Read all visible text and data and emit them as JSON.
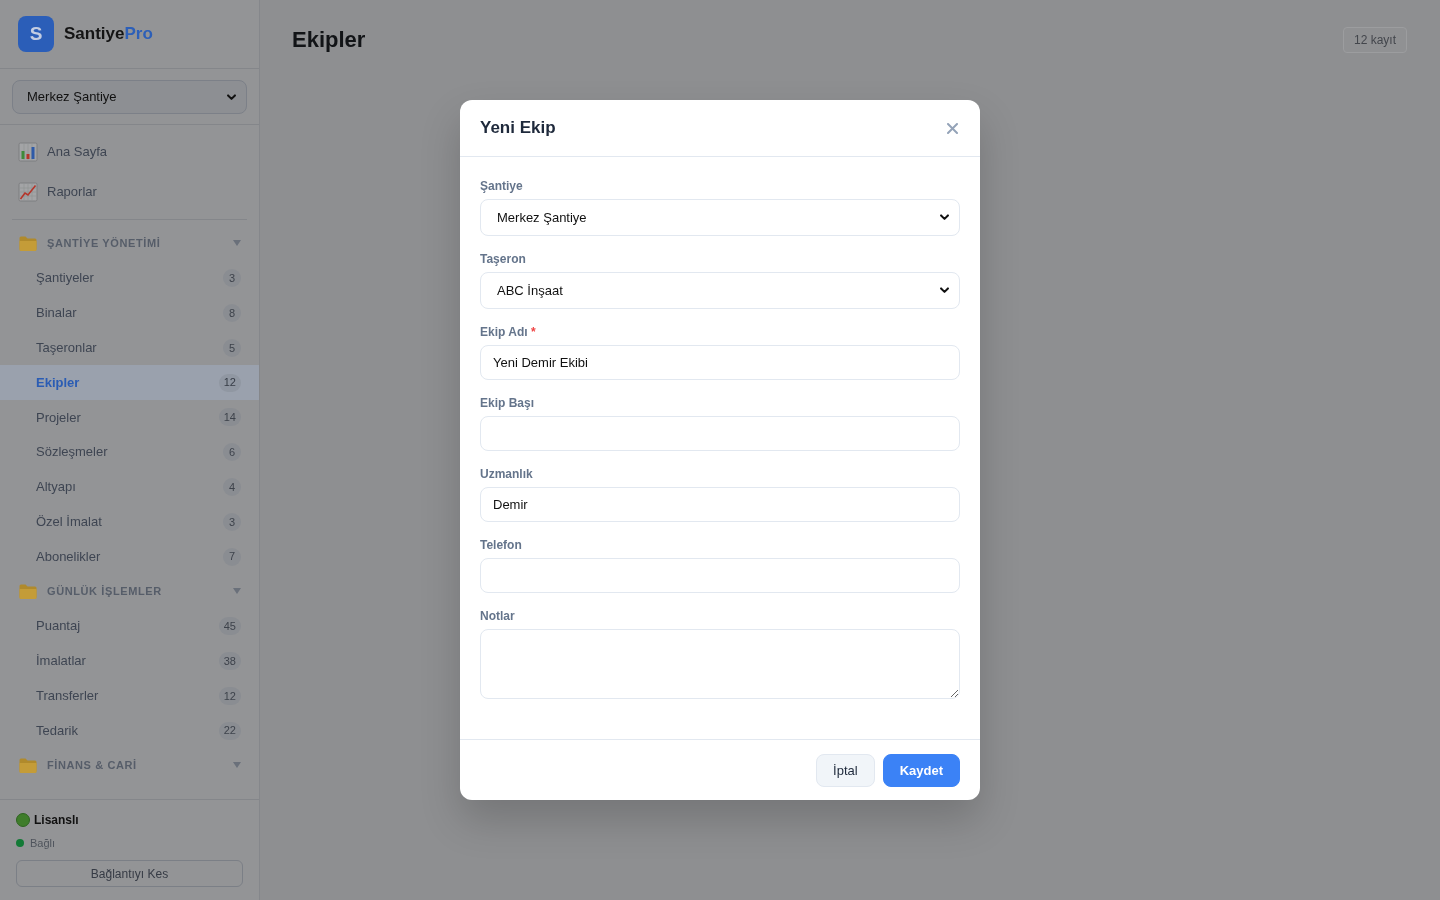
{
  "sidebar": {
    "brand": {
      "logo_letter": "S",
      "name": "Santiye",
      "name_accent": "Pro"
    },
    "site_select": {
      "value": "Merkez Şantiye"
    },
    "nav": [
      {
        "label": "Ana Sayfa",
        "selected": false
      },
      {
        "label": "Raporlar",
        "selected": false
      }
    ],
    "sections": [
      {
        "title": "ŞANTİYE YÖNETİMİ",
        "expanded": true,
        "items": [
          {
            "label": "Şantiyeler",
            "count": "3",
            "selected": false
          },
          {
            "label": "Binalar",
            "count": "8",
            "selected": false
          },
          {
            "label": "Taşeronlar",
            "count": "5",
            "selected": false
          },
          {
            "label": "Ekipler",
            "count": "12",
            "selected": true
          },
          {
            "label": "Projeler",
            "count": "14",
            "selected": false
          },
          {
            "label": "Sözleşmeler",
            "count": "6",
            "selected": false
          },
          {
            "label": "Altyapı",
            "count": "4",
            "selected": false
          },
          {
            "label": "Özel İmalat",
            "count": "3",
            "selected": false
          },
          {
            "label": "Abonelikler",
            "count": "7",
            "selected": false
          }
        ]
      },
      {
        "title": "GÜNLÜK İŞLEMLER",
        "expanded": true,
        "items": [
          {
            "label": "Puantaj",
            "count": "45",
            "selected": false
          },
          {
            "label": "İmalatlar",
            "count": "38",
            "selected": false
          },
          {
            "label": "Transferler",
            "count": "12",
            "selected": false
          },
          {
            "label": "Tedarik",
            "count": "22",
            "selected": false
          }
        ]
      },
      {
        "title": "FİNANS & CARİ",
        "expanded": true
      }
    ],
    "footer": {
      "license": "Lisanslı",
      "connection": "Bağlı",
      "connected": true,
      "disconnect_button": "Bağlantıyı Kes"
    }
  },
  "page": {
    "title": "Ekipler",
    "record_count": "12 kayıt"
  },
  "modal": {
    "title": "Yeni Ekip",
    "fields": [
      {
        "kind": "select",
        "label": "Şantiye",
        "value": "Merkez Şantiye"
      },
      {
        "kind": "select",
        "label": "Taşeron",
        "value": "ABC İnşaat"
      },
      {
        "kind": "text",
        "label": "Ekip Adı",
        "required_mark": "*",
        "value": "Yeni Demir Ekibi"
      },
      {
        "kind": "text",
        "label": "Ekip Başı"
      },
      {
        "kind": "text",
        "label": "Uzmanlık",
        "value": "Demir"
      },
      {
        "kind": "text",
        "label": "Telefon"
      },
      {
        "kind": "textarea",
        "label": "Notlar"
      }
    ],
    "buttons": [
      {
        "kind": "secondary",
        "label": "İptal"
      },
      {
        "kind": "primary",
        "label": "Kaydet"
      }
    ]
  }
}
